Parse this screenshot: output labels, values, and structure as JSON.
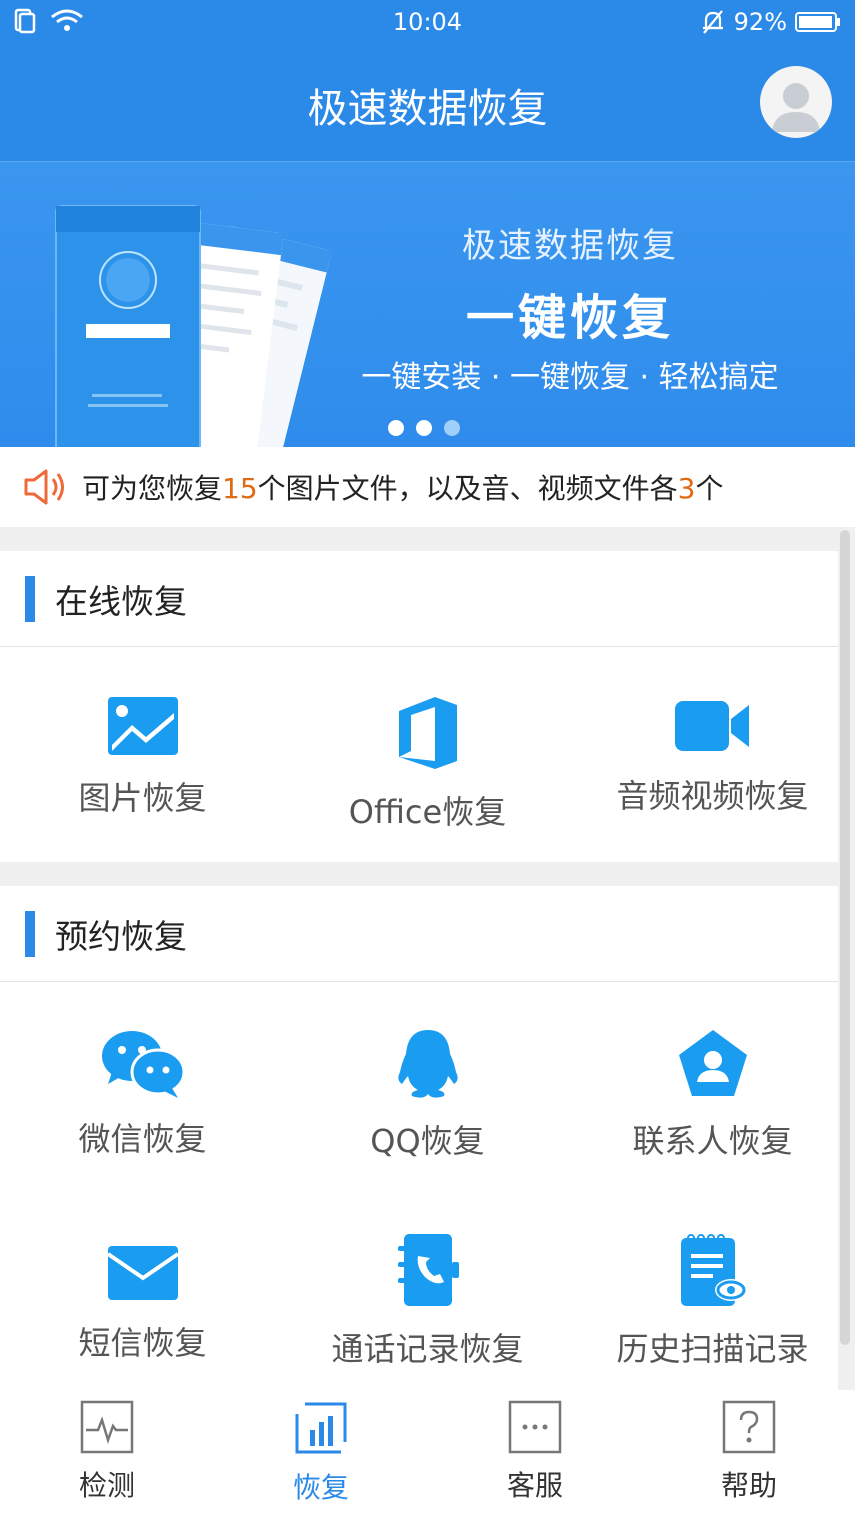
{
  "status_bar": {
    "time": "10:04",
    "battery": "92%"
  },
  "app": {
    "title": "极速数据恢复"
  },
  "banner": {
    "title": "极速数据恢复",
    "headline": "一键恢复",
    "subtitle": "一键安装 · 一键恢复 · 轻松搞定",
    "slide_count": 3,
    "active_slide": 2
  },
  "notice": {
    "prefix": "可为您恢复",
    "image_count": "15",
    "middle": "个图片文件，以及音、视频文件各",
    "media_count": "3",
    "suffix": "个"
  },
  "sections": [
    {
      "title": "在线恢复",
      "items": [
        {
          "label": "图片恢复",
          "icon": "image-icon"
        },
        {
          "label": "Office恢复",
          "icon": "office-icon"
        },
        {
          "label": "音频视频恢复",
          "icon": "video-camera-icon"
        }
      ]
    },
    {
      "title": "预约恢复",
      "items": [
        {
          "label": "微信恢复",
          "icon": "wechat-icon"
        },
        {
          "label": "QQ恢复",
          "icon": "qq-icon"
        },
        {
          "label": "联系人恢复",
          "icon": "contact-icon"
        },
        {
          "label": "短信恢复",
          "icon": "envelope-icon"
        },
        {
          "label": "通话记录恢复",
          "icon": "phone-book-icon"
        },
        {
          "label": "历史扫描记录",
          "icon": "history-doc-icon"
        }
      ]
    }
  ],
  "tabs": [
    {
      "label": "检测",
      "icon": "pulse-icon",
      "active": false
    },
    {
      "label": "恢复",
      "icon": "bar-chart-icon",
      "active": true
    },
    {
      "label": "客服",
      "icon": "chat-dots-icon",
      "active": false
    },
    {
      "label": "帮助",
      "icon": "question-icon",
      "active": false
    }
  ],
  "colors": {
    "primary": "#2b8ae8",
    "highlight": "#e06a14",
    "icon_blue": "#1a9cf0"
  }
}
